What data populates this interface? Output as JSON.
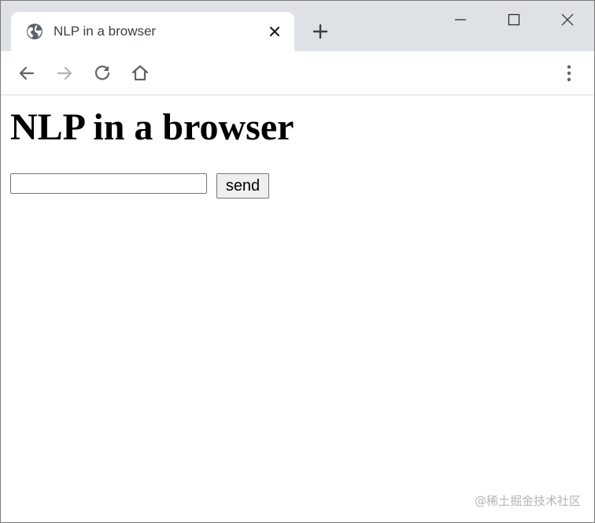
{
  "browser": {
    "tab": {
      "title": "NLP in a browser",
      "favicon_icon": "globe-icon",
      "close_icon": "close-icon"
    },
    "new_tab_icon": "plus-icon",
    "window_controls": {
      "minimize_icon": "minimize-icon",
      "maximize_icon": "maximize-icon",
      "close_icon": "close-icon"
    },
    "toolbar": {
      "back_icon": "arrow-left-icon",
      "forward_icon": "arrow-right-icon",
      "forward_enabled": false,
      "reload_icon": "reload-icon",
      "home_icon": "home-icon",
      "menu_icon": "vertical-dots-icon"
    }
  },
  "page": {
    "heading": "NLP in a browser",
    "input": {
      "value": "",
      "placeholder": ""
    },
    "send_label": "send"
  },
  "watermark": "@稀土掘金技术社区",
  "colors": {
    "tabstrip_bg": "#dee1e6",
    "icon": "#5f6368",
    "icon_disabled": "#b3b3b3"
  }
}
